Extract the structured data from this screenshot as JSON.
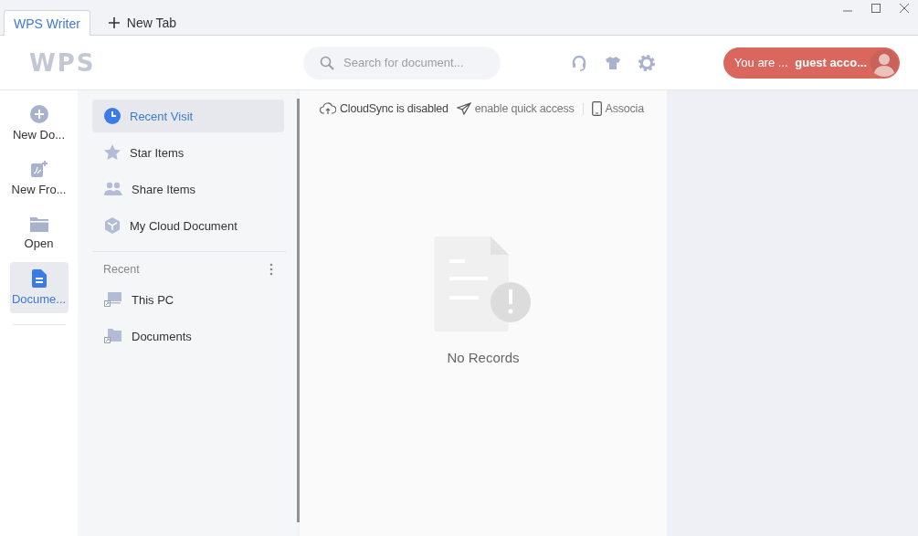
{
  "tabs": [
    {
      "label": "WPS Writer",
      "kind": "doc",
      "selected": true
    },
    {
      "label": "New Tab",
      "kind": "new",
      "selected": false
    }
  ],
  "header": {
    "logo": "WPS",
    "search": {
      "placeholder": "Search for document..."
    },
    "account": {
      "prefix": "You are ...",
      "name": "guest acco..."
    }
  },
  "nav": [
    {
      "label": "New Do...",
      "kind": "new",
      "selected": false
    },
    {
      "label": "New Fro...",
      "kind": "template",
      "selected": false
    },
    {
      "label": "Open",
      "kind": "open",
      "selected": false
    },
    {
      "label": "Docume...",
      "kind": "documents",
      "selected": true
    }
  ],
  "panel": {
    "items": [
      {
        "label": "Recent Visit",
        "kind": "recent",
        "selected": true
      },
      {
        "label": "Star Items",
        "kind": "star",
        "selected": false
      },
      {
        "label": "Share Items",
        "kind": "share",
        "selected": false
      },
      {
        "label": "My Cloud Document",
        "kind": "cloud",
        "selected": false
      }
    ],
    "recent_heading": "Recent",
    "locations": [
      {
        "label": "This PC",
        "kind": "pc"
      },
      {
        "label": "Documents",
        "kind": "folder"
      }
    ]
  },
  "toolbar": [
    {
      "label": "CloudSync is disabled",
      "kind": "cloud"
    },
    {
      "label": "enable quick access",
      "kind": "send"
    },
    {
      "label": "Associa",
      "kind": "phone"
    }
  ],
  "empty": {
    "message": "No Records"
  }
}
